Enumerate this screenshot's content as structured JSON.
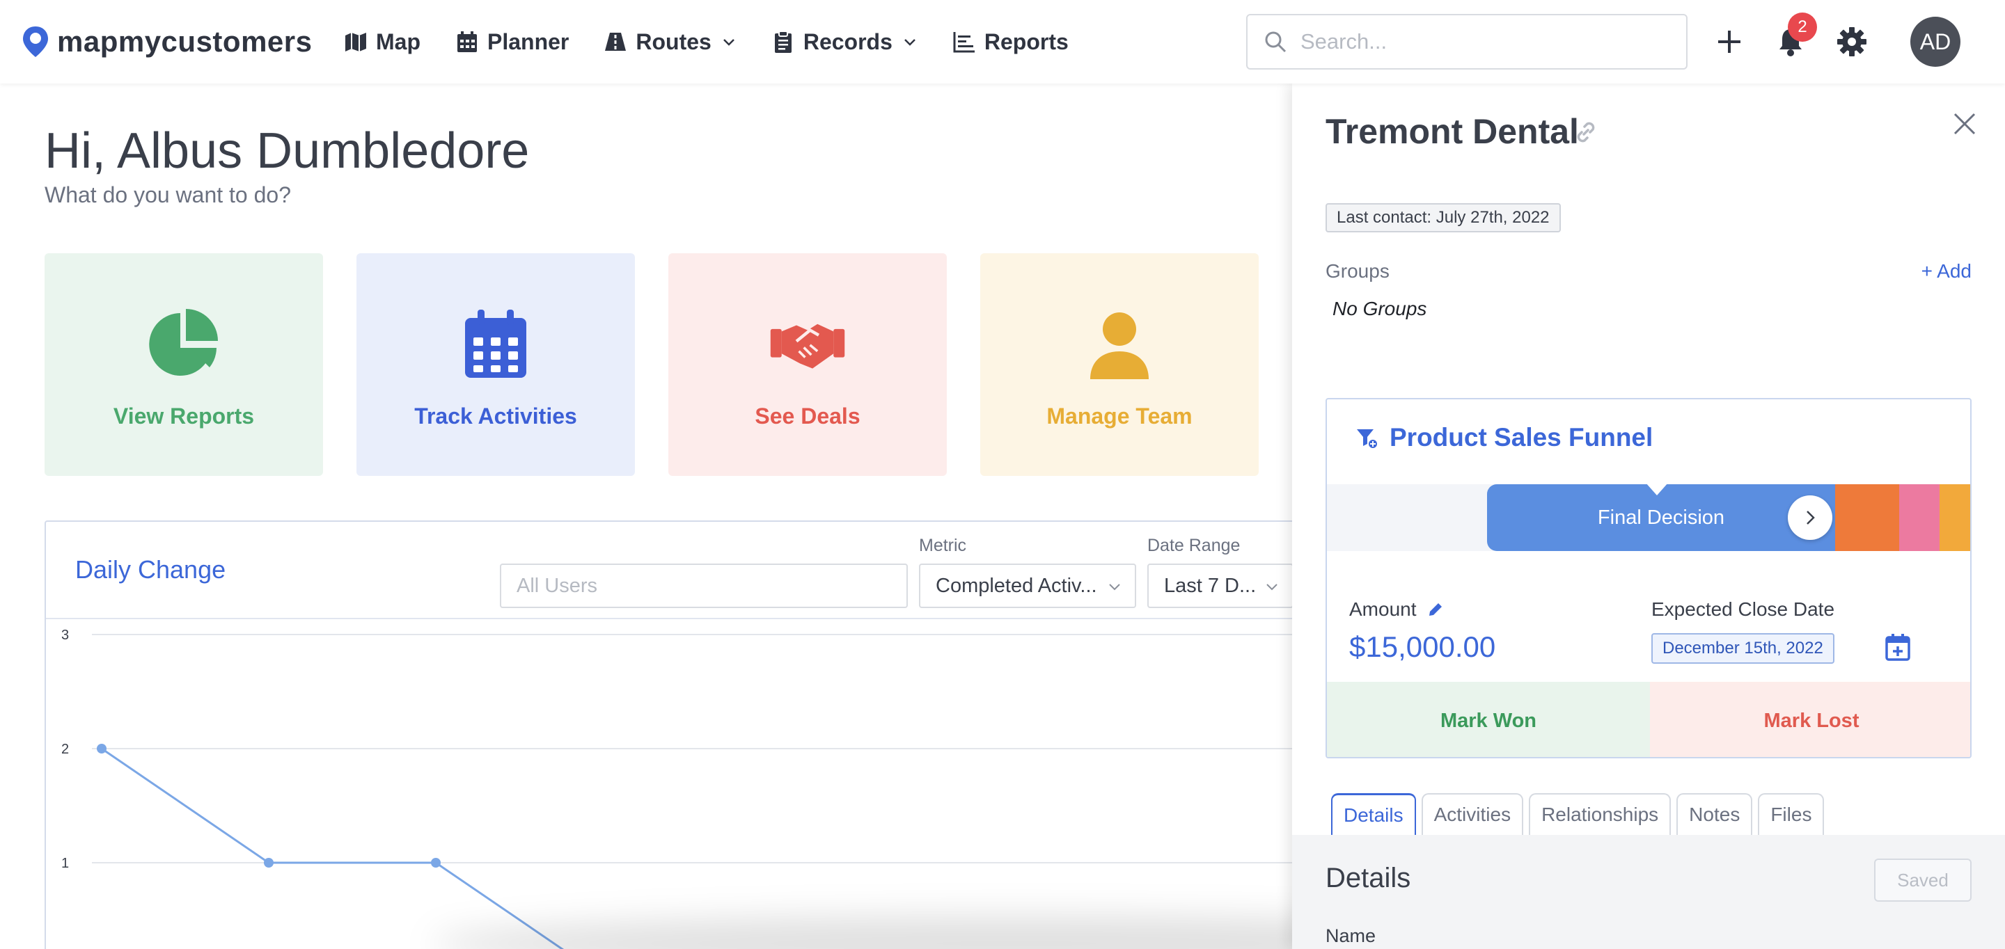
{
  "app": {
    "logo_text": "mapmycustomers"
  },
  "nav": {
    "items": [
      {
        "label": "Map",
        "icon": "map-icon"
      },
      {
        "label": "Planner",
        "icon": "calendar-icon"
      },
      {
        "label": "Routes",
        "icon": "road-icon",
        "dropdown": true
      },
      {
        "label": "Records",
        "icon": "clipboard-icon",
        "dropdown": true
      },
      {
        "label": "Reports",
        "icon": "chart-icon"
      }
    ]
  },
  "search": {
    "placeholder": "Search...",
    "value": ""
  },
  "notifications": {
    "count": "2"
  },
  "user": {
    "initials": "AD"
  },
  "home": {
    "greeting": "Hi, Albus Dumbledore",
    "subtitle": "What do you want to do?",
    "tiles": [
      {
        "label": "View Reports",
        "icon": "pie-chart-icon",
        "color": "#4aa86d",
        "bg": "#eaf5ee"
      },
      {
        "label": "Track Activities",
        "icon": "calendar-icon",
        "color": "#3c5fd6",
        "bg": "#e9eefb"
      },
      {
        "label": "See Deals",
        "icon": "handshake-icon",
        "color": "#e3594f",
        "bg": "#fdeceb"
      },
      {
        "label": "Manage Team",
        "icon": "person-icon",
        "color": "#e7ad35",
        "bg": "#fdf5e4"
      }
    ]
  },
  "daily_change": {
    "title": "Daily Change",
    "users_placeholder": "All Users",
    "metric_label": "Metric",
    "metric_value": "Completed Activ...",
    "date_range_label": "Date Range",
    "date_range_value": "Last 7 D..."
  },
  "chart_data": {
    "type": "line",
    "title": "Daily Change",
    "y_ticks": [
      "3",
      "2",
      "1"
    ],
    "ylim": [
      0,
      3
    ],
    "x_index": [
      0,
      1,
      2,
      3
    ],
    "series": [
      {
        "values": [
          2,
          1,
          1,
          0
        ]
      }
    ],
    "grid": true,
    "color": "#7ba7e6"
  },
  "panel": {
    "title": "Tremont Dental",
    "last_contact": "Last contact: July 27th, 2022",
    "groups_label": "Groups",
    "add_label": "+ Add",
    "no_groups": "No Groups",
    "funnel": {
      "name": "Product Sales Funnel",
      "active_stage": "Final Decision",
      "stage_colors": [
        "#5b8ee0",
        "#ee7a3a",
        "#ec7aa0",
        "#f2a93b"
      ]
    },
    "amount_label": "Amount",
    "amount_value": "$15,000.00",
    "close_date_label": "Expected Close Date",
    "close_date_value": "December 15th, 2022",
    "mark_won": "Mark Won",
    "mark_lost": "Mark Lost",
    "tabs": [
      "Details",
      "Activities",
      "Relationships",
      "Notes",
      "Files"
    ],
    "active_tab": "Details",
    "details_title": "Details",
    "saved_label": "Saved",
    "name_label": "Name"
  }
}
